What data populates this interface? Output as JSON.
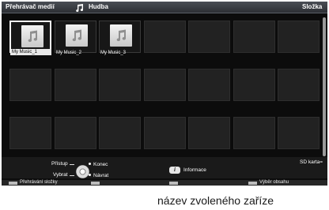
{
  "header": {
    "left_title": "Přehrávač medií",
    "category": "Hudba",
    "right_title": "Složka"
  },
  "tiles": [
    {
      "label": "My Music_1",
      "selected": true
    },
    {
      "label": "My Music_2",
      "selected": false
    },
    {
      "label": "My Music_3",
      "selected": false
    }
  ],
  "grid": {
    "rows": 3,
    "cols": 7
  },
  "hints": {
    "access": "Přístup",
    "select": "Vybrat",
    "exit": "Konec",
    "back": "Návrat",
    "info_button": "i",
    "info": "Informace",
    "sd_card": "SD karta="
  },
  "color_buttons": {
    "red": "Přehrávání složky",
    "green": "",
    "yellow": "",
    "blue": "Výběr obsahu"
  },
  "caption": "název zvoleného zaříze"
}
